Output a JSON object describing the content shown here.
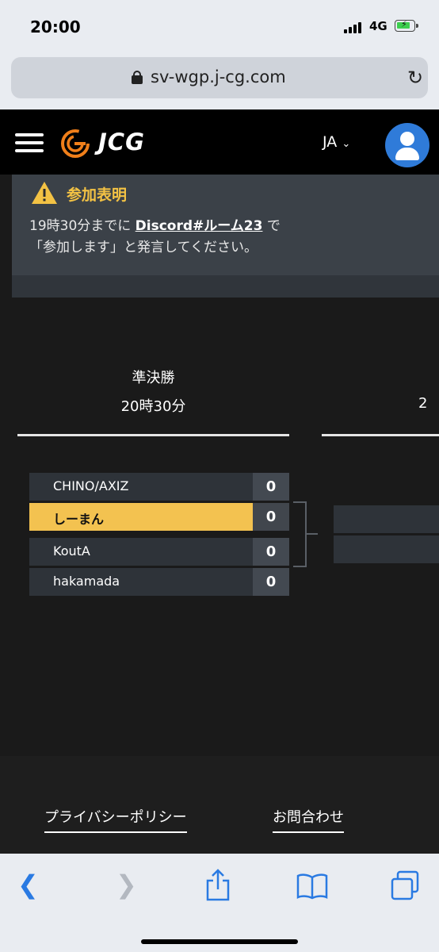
{
  "status_bar": {
    "time": "20:00",
    "network": "4G"
  },
  "browser": {
    "url": "sv-wgp.j-cg.com"
  },
  "app": {
    "logo": "JCG",
    "language": "JA"
  },
  "notice": {
    "title": "参加表明",
    "line1_prefix": "19時30分までに",
    "link": "Discord#ルーム23",
    "line1_suffix": "で",
    "line2": "「参加します」と発言してください。"
  },
  "round": {
    "name": "準決勝",
    "time": "20時30分",
    "next_partial": "2"
  },
  "matches": [
    {
      "players": [
        {
          "name": "CHINO/AXIZ",
          "score": "0"
        },
        {
          "name": "しーまん",
          "score": "0",
          "highlighted": true
        }
      ]
    },
    {
      "players": [
        {
          "name": "KoutA",
          "score": "0"
        },
        {
          "name": "hakamada",
          "score": "0"
        }
      ]
    }
  ],
  "footer": {
    "privacy": "プライバシーポリシー",
    "contact": "お問合わせ"
  },
  "colors": {
    "accent": "#f3c250",
    "avatar": "#2f7bd9",
    "link": "#2a7ae2"
  },
  "toolbar_icons": [
    "back-icon",
    "forward-icon",
    "share-icon",
    "bookmarks-icon",
    "tabs-icon"
  ]
}
